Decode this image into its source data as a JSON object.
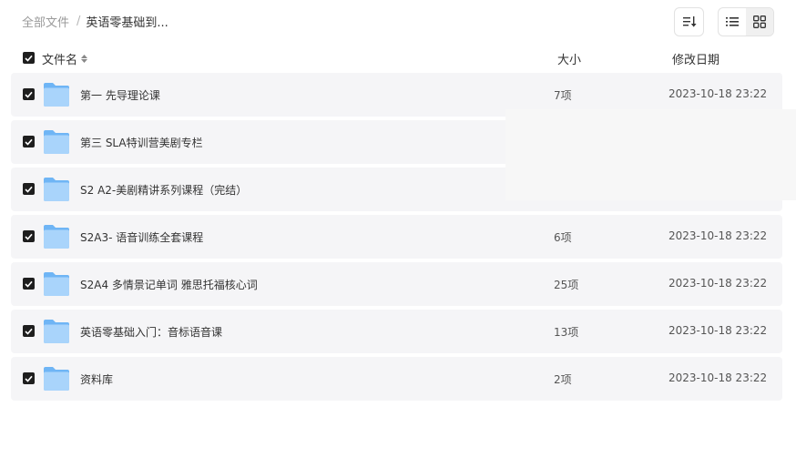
{
  "breadcrumb": {
    "root": "全部文件",
    "separator": "/",
    "current": "英语零基础到..."
  },
  "toolbar": {
    "sort_icon": "sort-icon",
    "list_view_icon": "list-view-icon",
    "grid_view_icon": "grid-view-icon",
    "active_view": "grid"
  },
  "table": {
    "headers": {
      "name": "文件名",
      "size": "大小",
      "date": "修改日期"
    },
    "rows": [
      {
        "name": "第一 先导理论课",
        "size": "7项",
        "date": "2023-10-18 23:22",
        "checked": true
      },
      {
        "name": "第三 SLA特训营美剧专栏",
        "size": "",
        "date": "",
        "checked": true
      },
      {
        "name": "S2 A2-美剧精讲系列课程（完结）",
        "size": "",
        "date": "",
        "checked": true
      },
      {
        "name": "S2A3- 语音训练全套课程",
        "size": "6项",
        "date": "2023-10-18 23:22",
        "checked": true
      },
      {
        "name": "S2A4 多情景记单词 雅思托福核心词",
        "size": "25项",
        "date": "2023-10-18 23:22",
        "checked": true
      },
      {
        "name": "英语零基础入门：音标语音课",
        "size": "13项",
        "date": "2023-10-18 23:22",
        "checked": true
      },
      {
        "name": "资料库",
        "size": "2项",
        "date": "2023-10-18 23:22",
        "checked": true
      }
    ]
  },
  "colors": {
    "row_background": "#f5f5f7",
    "checkbox": "#1e1e1e",
    "folder_light": "#a9d4fb",
    "folder_dark": "#6fb5f5"
  }
}
